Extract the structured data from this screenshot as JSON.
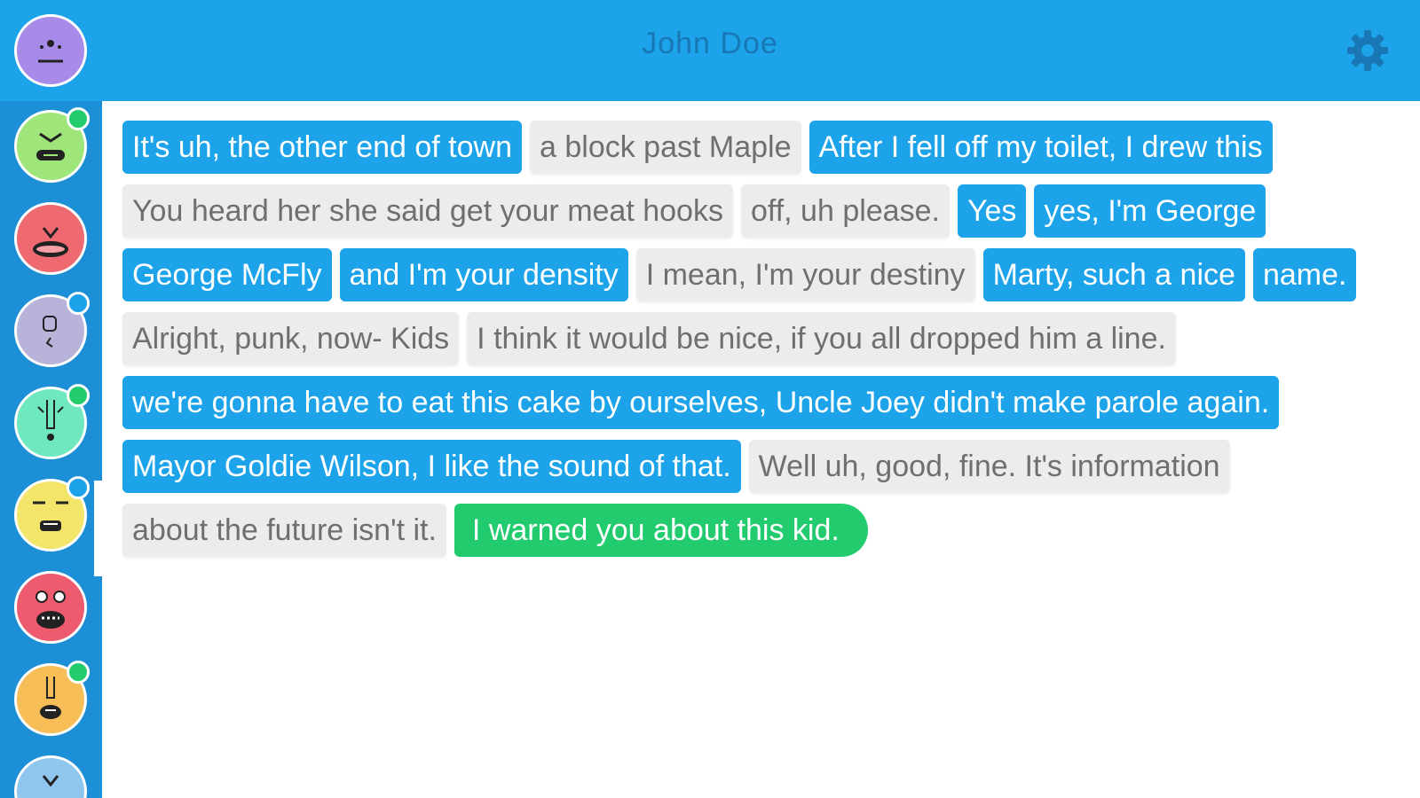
{
  "header": {
    "title": "John Doe"
  },
  "icons": {
    "settings": "gear-icon"
  },
  "colors": {
    "header": "#1ca3ea",
    "sidebar": "#1c8fd6",
    "sent_bubble": "#1ca3ea",
    "received_bubble": "#ececec",
    "pending_bubble": "#22cc6e",
    "online": "#22cc6e",
    "unread": "#1ca3ea"
  },
  "contacts": [
    {
      "face": "purple-face",
      "color": "#a88be8",
      "status": "none"
    },
    {
      "face": "green-face",
      "color": "#9ee57a",
      "status": "online"
    },
    {
      "face": "red-face",
      "color": "#ee6970",
      "status": "none"
    },
    {
      "face": "lavender-face",
      "color": "#b7b3d9",
      "status": "unread"
    },
    {
      "face": "mint-face",
      "color": "#6fe8bf",
      "status": "online"
    },
    {
      "face": "yellow-face",
      "color": "#f3e46a",
      "status": "unread"
    },
    {
      "face": "crimson-face",
      "color": "#ef5b6e",
      "status": "none"
    },
    {
      "face": "orange-face",
      "color": "#f7be57",
      "status": "online"
    },
    {
      "face": "blue-face",
      "color": "#8fc6ee",
      "status": "none"
    }
  ],
  "messages": [
    {
      "text": "It's uh, the other end of town",
      "kind": "sent"
    },
    {
      "text": "a block past Maple",
      "kind": "received"
    },
    {
      "text": "After I fell off my toilet, I drew this",
      "kind": "sent"
    },
    {
      "text": "You heard her she said get your meat hooks",
      "kind": "received"
    },
    {
      "text": "off, uh please.",
      "kind": "received"
    },
    {
      "text": "Yes",
      "kind": "sent"
    },
    {
      "text": "yes, I'm George",
      "kind": "sent"
    },
    {
      "text": "George McFly",
      "kind": "sent"
    },
    {
      "text": "and I'm your density",
      "kind": "sent"
    },
    {
      "text": "I mean, I'm your destiny",
      "kind": "received"
    },
    {
      "text": "Marty, such a nice",
      "kind": "sent"
    },
    {
      "text": "name.",
      "kind": "sent"
    },
    {
      "text": "Alright, punk, now- Kids",
      "kind": "received"
    },
    {
      "text": "I think it would be nice, if you all dropped him a line.",
      "kind": "received"
    },
    {
      "text": "we're gonna have to eat this cake by ourselves, Uncle Joey didn't make parole again.",
      "kind": "sent"
    },
    {
      "text": "Mayor Goldie Wilson, I like the sound of that.",
      "kind": "sent"
    },
    {
      "text": "Well uh, good, fine. It's information",
      "kind": "received"
    },
    {
      "text": "about the future isn't it.",
      "kind": "received"
    },
    {
      "text": "I warned you about this kid.",
      "kind": "pending"
    }
  ]
}
